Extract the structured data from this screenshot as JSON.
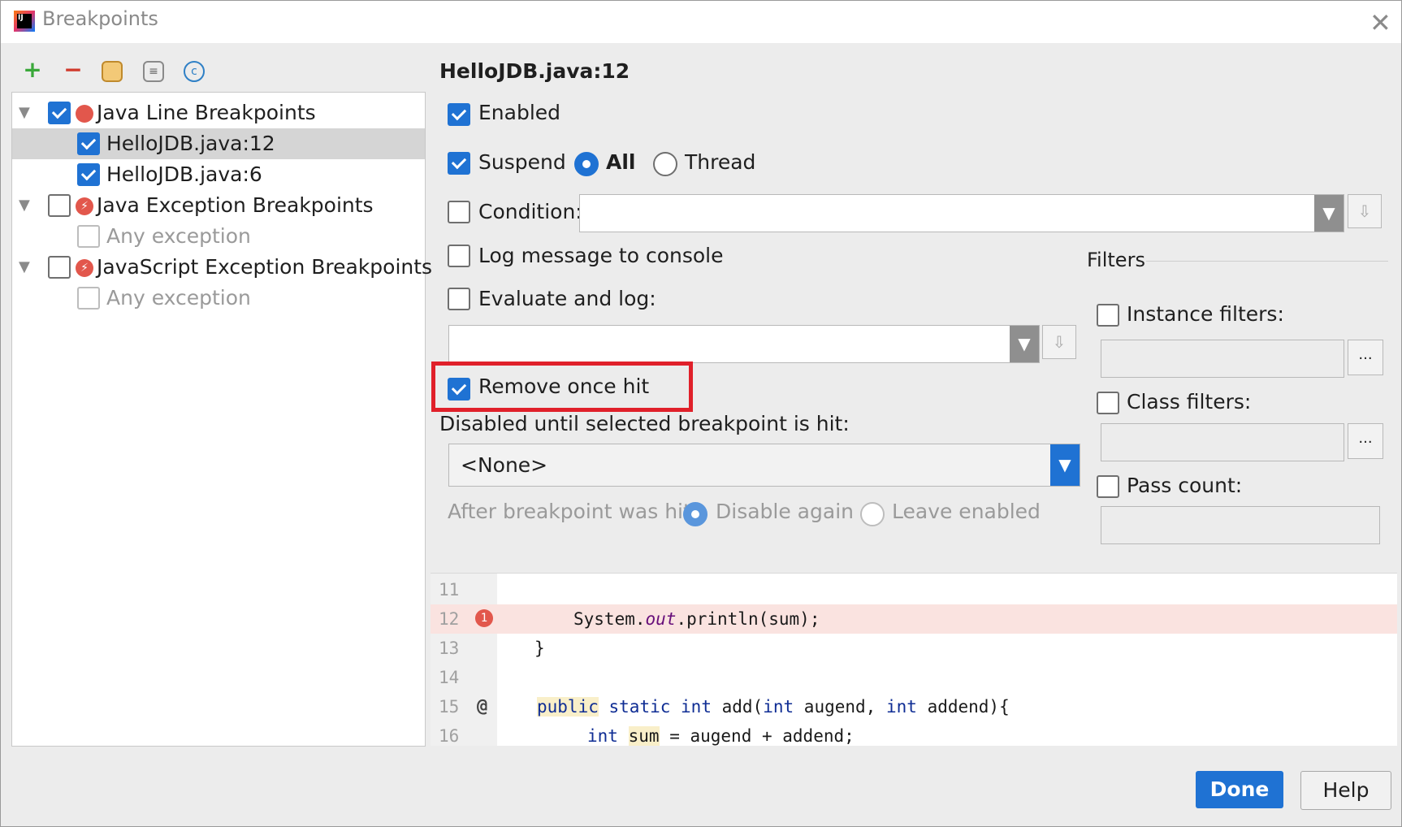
{
  "window": {
    "title": "Breakpoints"
  },
  "toolbar": {
    "add": "+",
    "remove": "−"
  },
  "tree": {
    "groups": [
      {
        "label": "Java Line Breakpoints",
        "children": [
          "HelloJDB.java:12",
          "HelloJDB.java:6"
        ]
      },
      {
        "label": "Java Exception Breakpoints",
        "children": [
          "Any exception"
        ]
      },
      {
        "label": "JavaScript Exception Breakpoints",
        "children": [
          "Any exception"
        ]
      }
    ]
  },
  "details": {
    "title": "HelloJDB.java:12",
    "enabled": "Enabled",
    "suspend": "Suspend",
    "all": "All",
    "thread": "Thread",
    "condition": "Condition:",
    "log_message": "Log message to console",
    "evaluate_log": "Evaluate and log:",
    "remove_once_hit": "Remove once hit",
    "disabled_until": "Disabled until selected breakpoint is hit:",
    "none_value": "<None>",
    "after_hit": "After breakpoint was hit",
    "disable_again": "Disable again",
    "leave_enabled": "Leave enabled"
  },
  "filters": {
    "title": "Filters",
    "instance": "Instance filters:",
    "class": "Class filters:",
    "pass_count": "Pass count:",
    "browse": "..."
  },
  "code": {
    "lines": [
      "11",
      "12",
      "13",
      "14",
      "15",
      "16"
    ],
    "bp_badge": "1",
    "at_badge": "@",
    "l12a": "System.",
    "l12b": "out",
    "l12c": ".println(sum);",
    "l13": "}",
    "l15_public": "public",
    "l15_static": "static",
    "l15_int": "int",
    "l15_rest1": "add(",
    "l15_int2": "int",
    "l15_rest2": "augend,",
    "l15_int3": "int",
    "l15_rest3": "addend){",
    "l16_int": "int",
    "l16_sum": "sum",
    "l16_rest": "= augend + addend;"
  },
  "buttons": {
    "done": "Done",
    "help": "Help"
  },
  "colors": {
    "accent": "#1f72d3",
    "highlight_box": "#e0202a",
    "breakpoint": "#e2574c"
  }
}
